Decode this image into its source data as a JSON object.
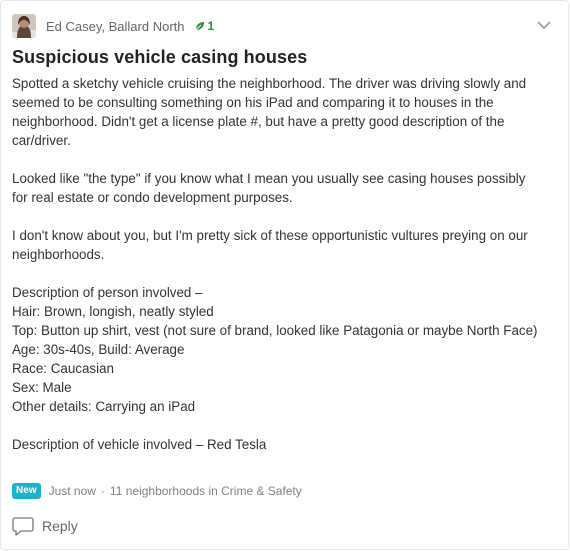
{
  "post": {
    "author": "Ed Casey, Ballard North",
    "thanks_count": "1",
    "title": "Suspicious vehicle casing houses",
    "paragraphs": [
      "Spotted a sketchy vehicle cruising the neighborhood. The driver was driving slowly and seemed to be consulting something on his iPad and comparing it to houses in the neighborhood. Didn't get a license plate #, but have a pretty good description of the car/driver.",
      "Looked like \"the type\" if you know what I mean you usually see casing houses possibly for real estate or condo development purposes.",
      "I don't know about you, but I'm pretty sick of these opportunistic vultures preying on our neighborhoods.",
      "Description of person involved –\nHair: Brown, longish, neatly styled\nTop: Button up shirt, vest (not sure of brand, looked like Patagonia or maybe North Face)\nAge: 30s-40s, Build: Average\nRace: Caucasian\nSex: Male\nOther details: Carrying an iPad",
      "Description of vehicle involved – Red Tesla"
    ],
    "badge": "New",
    "time": "Just now",
    "separator": "·",
    "audience": "11 neighborhoods in Crime & Safety",
    "reply_label": "Reply"
  },
  "icons": {
    "thanks": "leaf-thank-icon",
    "menu": "chevron-down-icon",
    "reply": "comment-bubble-icon"
  },
  "colors": {
    "badge": "#1bb3c9",
    "thanks": "#2e8b3a",
    "title": "#222222",
    "body_text": "#333333",
    "muted": "#808080"
  }
}
